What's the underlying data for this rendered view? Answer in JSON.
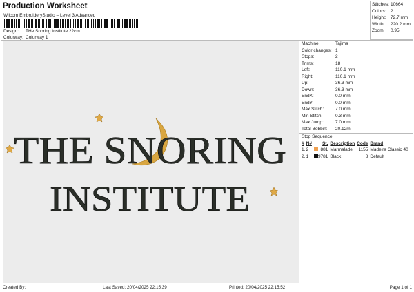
{
  "header": {
    "title": "Production Worksheet",
    "subtitle": "Wilcom EmbroideryStudio – Level 3 Advanced",
    "design_label": "Design:",
    "design_value": "THe Snoring Institute 22cm",
    "colorway_label": "Colorway:",
    "colorway_value": "Colorway 1"
  },
  "stats": [
    {
      "k": "Stitches:",
      "v": "10664"
    },
    {
      "k": "Colors:",
      "v": "2"
    },
    {
      "k": "Height:",
      "v": "72.7 mm"
    },
    {
      "k": "Width:",
      "v": "220.2 mm"
    },
    {
      "k": "Zoom:",
      "v": "0.95"
    }
  ],
  "info": [
    {
      "k": "Machine:",
      "v": "Tajima"
    },
    {
      "k": "Color changes:",
      "v": "1"
    },
    {
      "k": "Stops:",
      "v": "2"
    },
    {
      "k": "Trims:",
      "v": "18"
    },
    {
      "k": "Left:",
      "v": "110.1 mm"
    },
    {
      "k": "Right:",
      "v": "110.1 mm"
    },
    {
      "k": "Up:",
      "v": "36.3 mm"
    },
    {
      "k": "Down:",
      "v": "36.3 mm"
    },
    {
      "k": "EndX:",
      "v": "0.0 mm"
    },
    {
      "k": "EndY:",
      "v": "0.0 mm"
    },
    {
      "k": "Max Stitch:",
      "v": "7.0 mm"
    },
    {
      "k": "Min Stitch:",
      "v": "0.3 mm"
    },
    {
      "k": "Max Jump:",
      "v": "7.0 mm"
    },
    {
      "k": "Total Bobbin:",
      "v": "20.12m"
    }
  ],
  "stop_sequence": {
    "title": "Stop Sequence:",
    "headers": [
      "#",
      "N#",
      "St.",
      "Description",
      "Code",
      "Brand"
    ],
    "rows": [
      {
        "n": "1.",
        "nn": "2",
        "color": "#f0a050",
        "st": "881",
        "desc": "Marmalade",
        "code": "1155",
        "brand": "Madeira Classic 40"
      },
      {
        "n": "2.",
        "nn": "1",
        "color": "#111111",
        "st": "9781",
        "desc": "Black",
        "code": "8",
        "brand": "Default"
      }
    ]
  },
  "design": {
    "line1": "THE SNORING",
    "line2": "INSTITUTE",
    "thread_black": "#2a2e28",
    "thread_gold": "#d9a640"
  },
  "footer": {
    "created": "Created By:",
    "saved": "Last Saved: 20/04/2025 22:15:39",
    "printed": "Printed: 20/04/2025 22:15:52",
    "page": "Page 1 of 1"
  }
}
